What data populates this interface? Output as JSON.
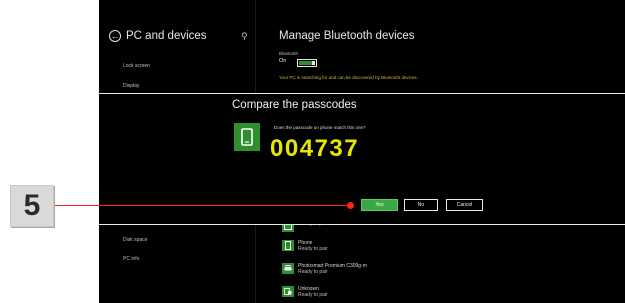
{
  "left_pane": {
    "title": "PC and devices",
    "nav": [
      "Lock screen",
      "Display",
      "Disk space",
      "PC info"
    ]
  },
  "right_pane": {
    "title": "Manage Bluetooth devices",
    "bluetooth_label": "Bluetooth",
    "bluetooth_state": "On",
    "description": "Your PC is searching for and can be discovered by Bluetooth devices.",
    "devices": [
      {
        "name": "",
        "status": "Ready to pair",
        "icon": "device-icon"
      },
      {
        "name": "Phone",
        "status": "Ready to pair",
        "icon": "phone-icon"
      },
      {
        "name": "Photosmart Premium C309g-m",
        "status": "Ready to pair",
        "icon": "printer-icon"
      },
      {
        "name": "Unknown",
        "status": "Ready to pair",
        "icon": "unknown-device-icon"
      }
    ]
  },
  "dialog": {
    "title": "Compare the passcodes",
    "prompt": "Does the passcode on phone match this one?",
    "passcode": "004737",
    "buttons": {
      "yes": "Yes",
      "no": "No",
      "cancel": "Cancel"
    }
  },
  "callout": {
    "step": "5"
  },
  "colors": {
    "accent_green": "#2f8f2f",
    "button_green": "#39a845",
    "passcode_yellow": "#e6e600",
    "callout_red": "#ff2020"
  }
}
